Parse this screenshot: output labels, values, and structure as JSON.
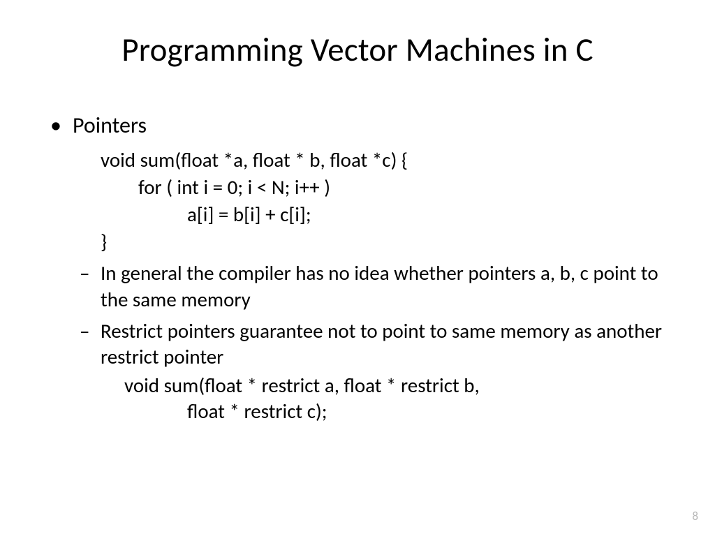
{
  "title": "Programming Vector Machines in C",
  "bullet1": "Pointers",
  "code": {
    "line1": "void sum(float *a, float * b, float *c) {",
    "line2": "for ( int i = 0; i < N; i++ )",
    "line3": "a[i] = b[i] + c[i];",
    "line4": "}"
  },
  "sub1": "In general the compiler has no idea whether pointers a, b, c point to the same memory",
  "sub2": "Restrict pointers guarantee not to point to same memory as another restrict pointer",
  "code2": {
    "line1": "void sum(float * restrict a, float * restrict b,",
    "line2": "float * restrict c);"
  },
  "page": "8"
}
